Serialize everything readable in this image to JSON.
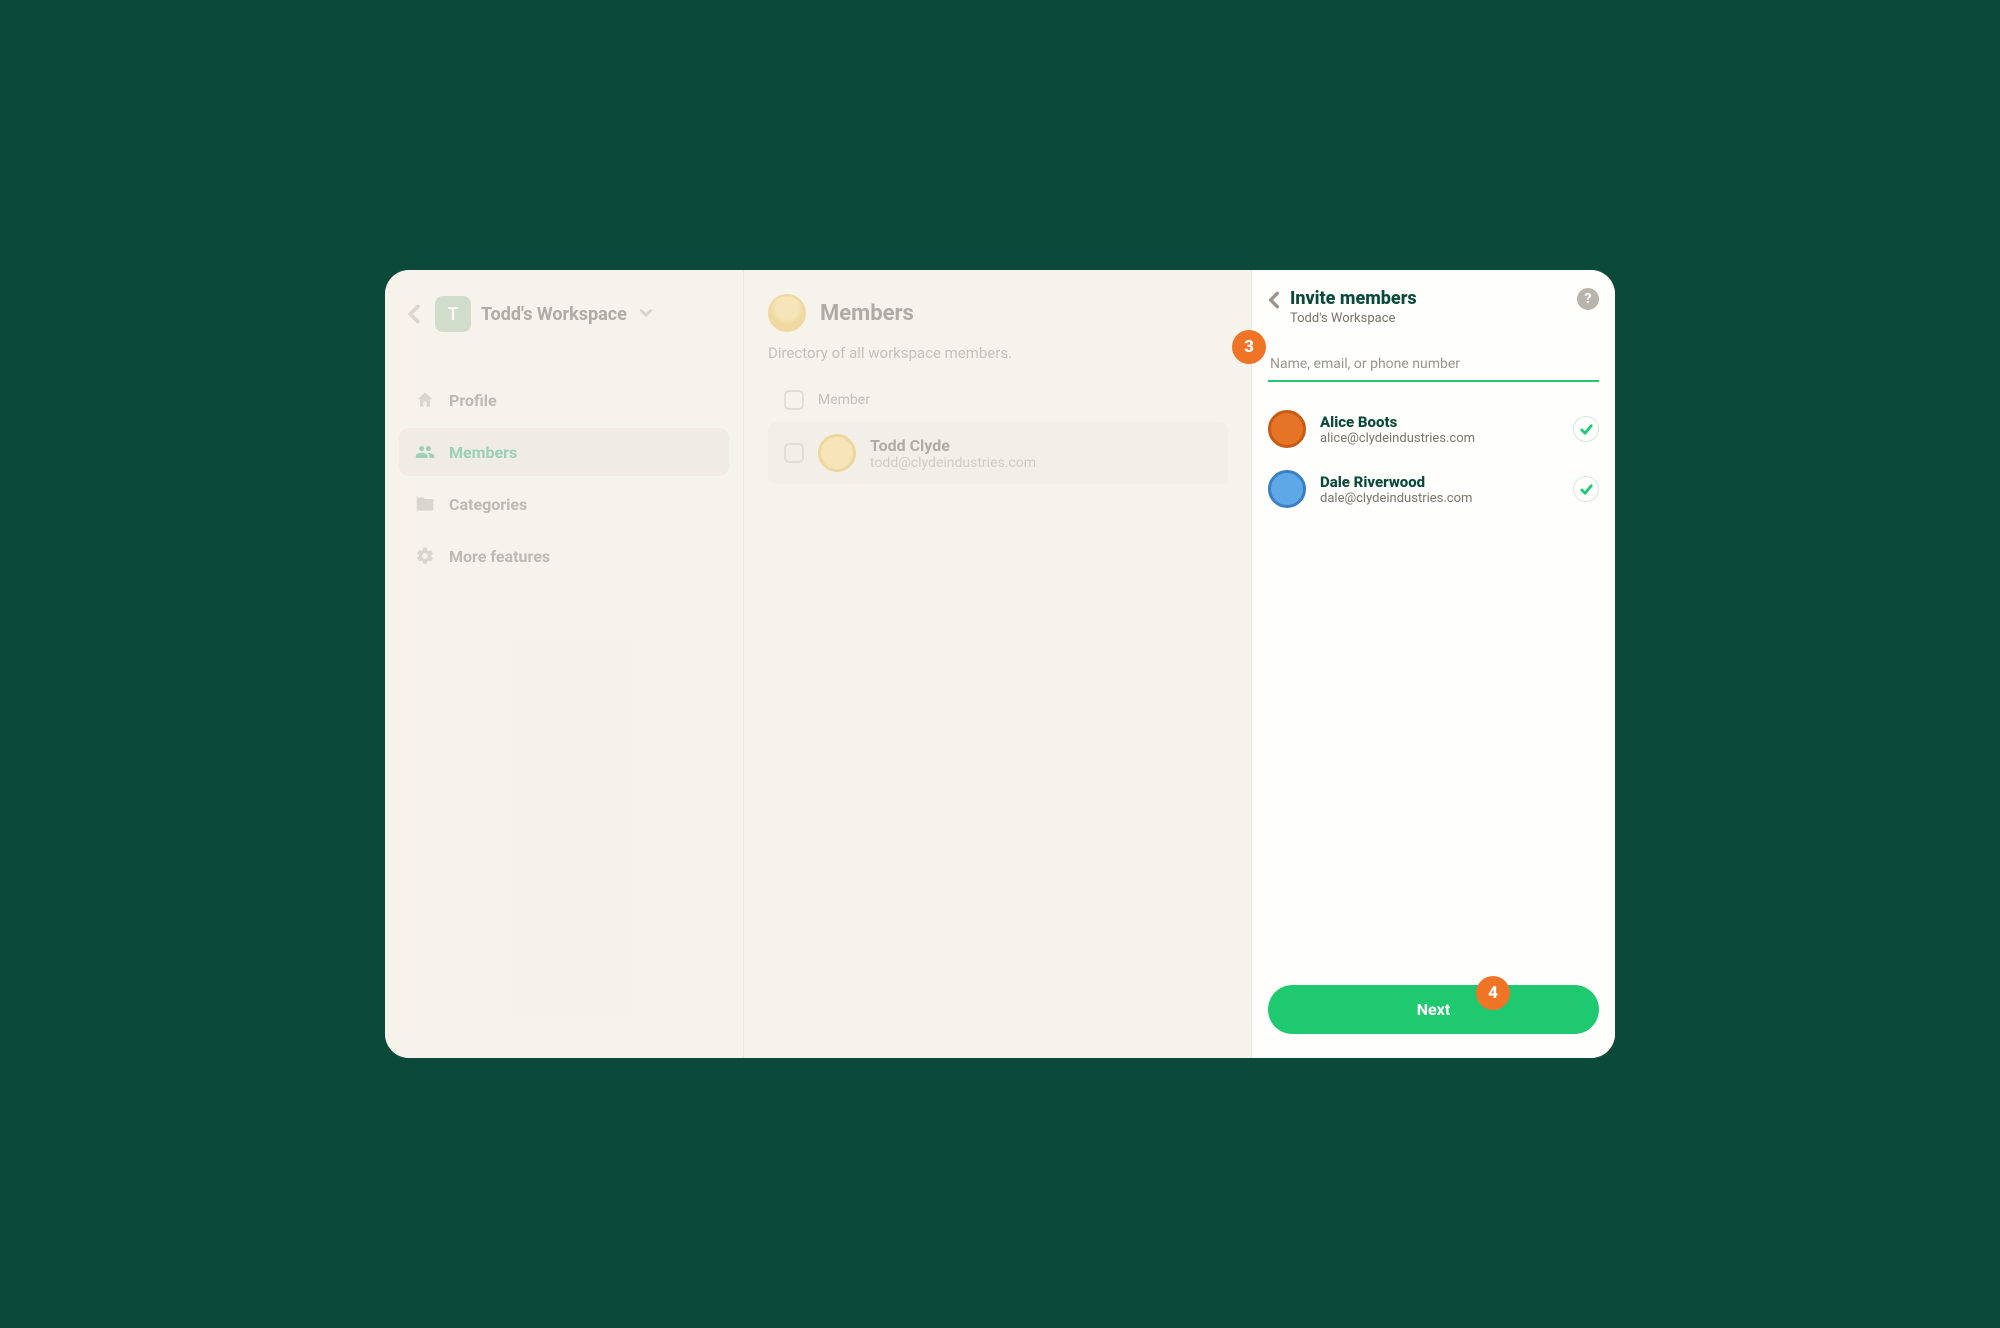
{
  "workspace": {
    "badge": "T",
    "name": "Todd's Workspace"
  },
  "sidebar": {
    "items": [
      {
        "label": "Profile"
      },
      {
        "label": "Members"
      },
      {
        "label": "Categories"
      },
      {
        "label": "More features"
      }
    ]
  },
  "main": {
    "title": "Members",
    "subtitle": "Directory of all workspace members.",
    "column_header": "Member",
    "members": [
      {
        "name": "Todd Clyde",
        "email": "todd@clydeindustries.com"
      }
    ]
  },
  "panel": {
    "title": "Invite members",
    "subtitle": "Todd's Workspace",
    "input_placeholder": "Name, email, or phone number",
    "next_label": "Next",
    "invitees": [
      {
        "name": "Alice Boots",
        "email": "alice@clydeindustries.com",
        "avatar_color": "orange"
      },
      {
        "name": "Dale Riverwood",
        "email": "dale@clydeindustries.com",
        "avatar_color": "blue"
      }
    ]
  },
  "callouts": {
    "step3": "3",
    "step4": "4"
  }
}
